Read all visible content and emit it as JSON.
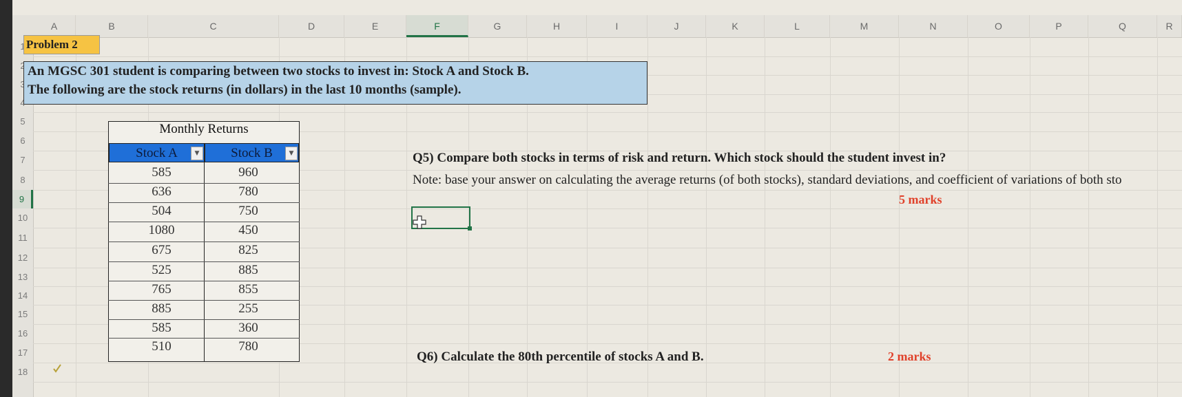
{
  "columns": [
    "A",
    "B",
    "C",
    "D",
    "E",
    "F",
    "G",
    "H",
    "I",
    "J",
    "K",
    "L",
    "M",
    "N",
    "O",
    "P",
    "Q",
    "R"
  ],
  "selected_column": "F",
  "rows": [
    "1",
    "2",
    "3",
    "4",
    "5",
    "6",
    "7",
    "8",
    "9",
    "10",
    "11",
    "12",
    "13",
    "14",
    "15",
    "16",
    "17",
    "18"
  ],
  "selected_row": "9",
  "problem_label": "Problem 2",
  "intro": {
    "line1": "An MGSC 301 student is comparing between two stocks to invest in: Stock A and Stock B.",
    "line2": "The following are the stock returns (in dollars) in the last 10 months (sample)."
  },
  "table": {
    "title": "Monthly Returns",
    "headers": [
      "Stock A",
      "Stock B"
    ],
    "stock_a": [
      "585",
      "636",
      "504",
      "1080",
      "675",
      "525",
      "765",
      "885",
      "585",
      "510"
    ],
    "stock_b": [
      "960",
      "780",
      "750",
      "450",
      "825",
      "885",
      "855",
      "255",
      "360",
      "780"
    ]
  },
  "q5": {
    "question": "Q5) Compare both stocks in terms of risk and return. Which stock should the student invest in?",
    "note": "Note: base your answer on calculating the average returns (of both stocks), standard deviations, and coefficient of variations of both sto",
    "marks": "5 marks"
  },
  "q6": {
    "question": "Q6) Calculate the 80th percentile of stocks A and B.",
    "marks": "2 marks"
  },
  "colors": {
    "header_fill": "#1f6fd8",
    "problem_fill": "#f6c343",
    "intro_fill": "#b6d3e8",
    "marks": "#e0412a",
    "selection": "#217346"
  }
}
